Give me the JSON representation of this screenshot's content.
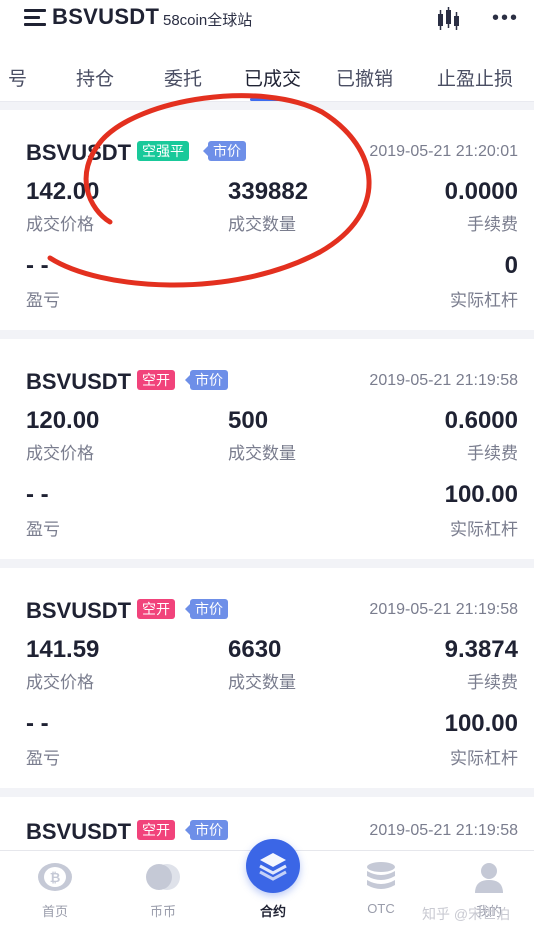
{
  "header": {
    "title": "BSVUSDT",
    "subtitle": "58coin全球站"
  },
  "tabs": [
    {
      "label": "号"
    },
    {
      "label": "持仓"
    },
    {
      "label": "委托"
    },
    {
      "label": "已成交"
    },
    {
      "label": "已撤销"
    },
    {
      "label": "止盈止损"
    }
  ],
  "labels": {
    "price": "成交价格",
    "qty": "成交数量",
    "fee": "手续费",
    "pnl": "盈亏",
    "leverage": "实际杠杆"
  },
  "trades": [
    {
      "symbol": "BSVUSDT",
      "side": "空强平",
      "type": "市价",
      "time": "2019-05-21 21:20:01",
      "price": "142.00",
      "qty": "339882",
      "fee": "0.0000",
      "pnl": "- -",
      "leverage": "0"
    },
    {
      "symbol": "BSVUSDT",
      "side": "空开",
      "type": "市价",
      "time": "2019-05-21 21:19:58",
      "price": "120.00",
      "qty": "500",
      "fee": "0.6000",
      "pnl": "- -",
      "leverage": "100.00"
    },
    {
      "symbol": "BSVUSDT",
      "side": "空开",
      "type": "市价",
      "time": "2019-05-21 21:19:58",
      "price": "141.59",
      "qty": "6630",
      "fee": "9.3874",
      "pnl": "- -",
      "leverage": "100.00"
    },
    {
      "symbol": "BSVUSDT",
      "side": "空开",
      "type": "市价",
      "time": "2019-05-21 21:19:58"
    }
  ],
  "nav": [
    {
      "label": "首页",
      "icon": "bitcoin-coin-icon"
    },
    {
      "label": "币币",
      "icon": "coins-icon"
    },
    {
      "label": "合约",
      "icon": "layers-icon"
    },
    {
      "label": "OTC",
      "icon": "database-stack-icon"
    },
    {
      "label": "我的",
      "icon": "user-icon"
    }
  ],
  "watermark": "知乎 @宋世泊",
  "colors": {
    "accent": "#3b66e6",
    "badge_green": "#19c99a",
    "badge_pink": "#f1437b",
    "badge_blue": "#6e8fe8",
    "annotation_red": "#e3301f"
  }
}
